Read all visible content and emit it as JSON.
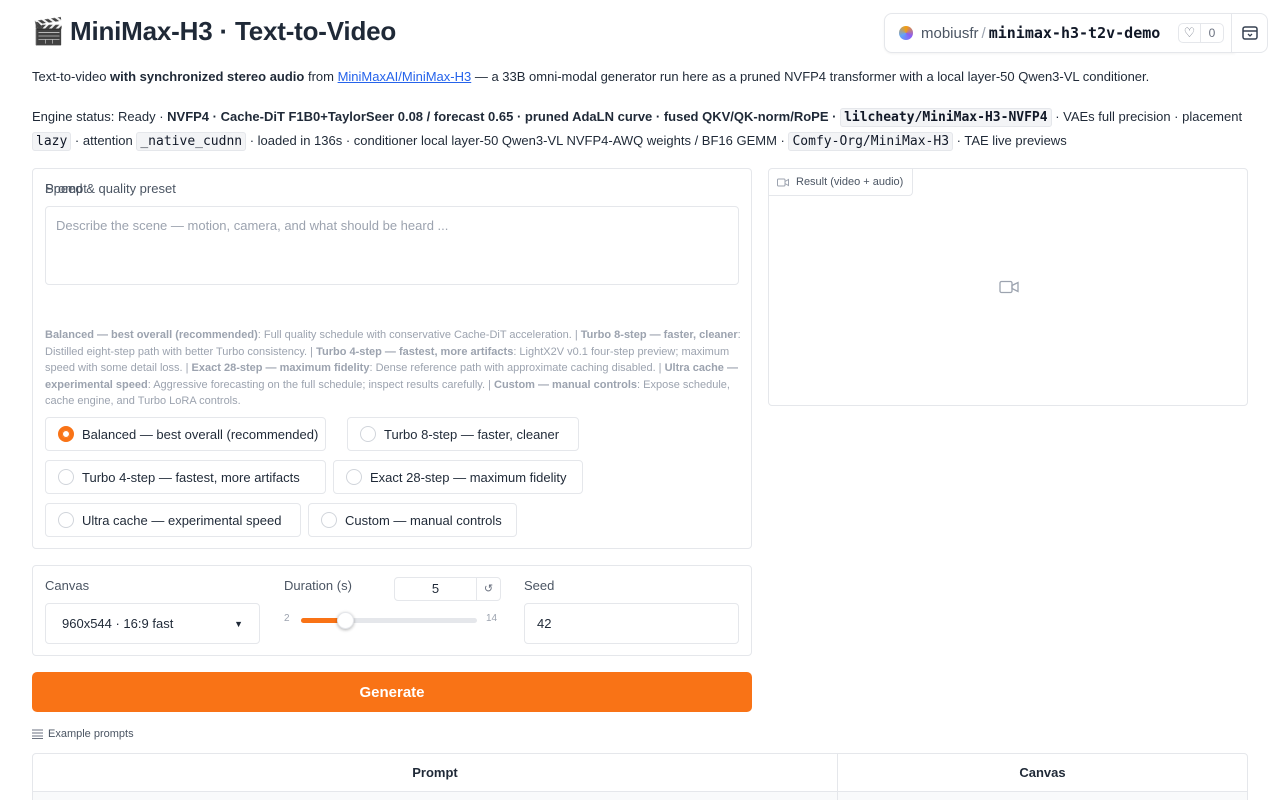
{
  "header": {
    "emoji": "🎬",
    "title": "MiniMax-H3 · Text-to-Video"
  },
  "hf_badge": {
    "user": "mobiusfr",
    "separator": "/",
    "space": "minimax-h3-t2v-demo",
    "likes": "0"
  },
  "intro": {
    "prefix": "Text-to-video ",
    "bold": "with synchronized stereo audio",
    "from": " from ",
    "link": "MiniMaxAI/MiniMax-H3",
    "suffix": " — a 33B omni-modal generator run here as a pruned NVFP4 transformer with a local layer-50 Qwen3-VL conditioner."
  },
  "status": {
    "prefix": "Engine status: Ready · ",
    "bold": "NVFP4 · Cache-DiT F1B0+TaylorSeer 0.08 / forecast 0.65 · pruned AdaLN curve · fused QKV/QK-norm/RoPE ·",
    "model_code": "lilcheaty/MiniMax-H3-NVFP4",
    "vae_text": " · VAEs full precision · placement ",
    "placement_code": "lazy",
    "attention_text": " · attention ",
    "attention_code": "_native_cudnn",
    "loaded_text": " · loaded in 136s · conditioner local layer-50 Qwen3-VL NVFP4-AWQ weights / BF16 GEMM · ",
    "comfy_code": "Comfy-Org/MiniMax-H3",
    "tail_text": " · TAE live previews"
  },
  "prompt": {
    "label": "Prompt",
    "placeholder": "Describe the scene — motion, camera, and what should be heard ..."
  },
  "preset": {
    "label": "Speed & quality preset",
    "info": [
      {
        "name": "Balanced — best overall (recommended)",
        "desc": ": Full quality schedule with conservative Cache-DiT acceleration. | "
      },
      {
        "name": "Turbo 8-step — faster, cleaner",
        "desc": ": Distilled eight-step path with better Turbo consistency. | "
      },
      {
        "name": "Turbo 4-step — fastest, more artifacts",
        "desc": ": LightX2V v0.1 four-step preview; maximum speed with some detail loss. | "
      },
      {
        "name": "Exact 28-step — maximum fidelity",
        "desc": ": Dense reference path with approximate caching disabled. | "
      },
      {
        "name": "Ultra cache — experimental speed",
        "desc": ": Aggressive forecasting on the full schedule; inspect results carefully. | "
      },
      {
        "name": "Custom — manual controls",
        "desc": ": Expose schedule, cache engine, and Turbo LoRA controls."
      }
    ],
    "options": [
      "Balanced — best overall (recommended)",
      "Turbo 8-step — faster, cleaner",
      "Turbo 4-step — fastest, more artifacts",
      "Exact 28-step — maximum fidelity",
      "Ultra cache — experimental speed",
      "Custom — manual controls"
    ],
    "selected_index": 0
  },
  "settings": {
    "canvas_label": "Canvas",
    "canvas_value": "960x544 · 16:9 fast",
    "duration_label": "Duration (s)",
    "duration_value": "5",
    "duration_reset": "↺",
    "duration_min": "2",
    "duration_max": "14",
    "duration_fraction": 0.25,
    "seed_label": "Seed",
    "seed_value": "42"
  },
  "generate_label": "Generate",
  "result": {
    "label": "Result (video + audio)"
  },
  "examples": {
    "label": "Example prompts",
    "columns": [
      "Prompt",
      "Canvas"
    ]
  },
  "colors": {
    "accent": "#f97316",
    "link": "#2563eb"
  }
}
